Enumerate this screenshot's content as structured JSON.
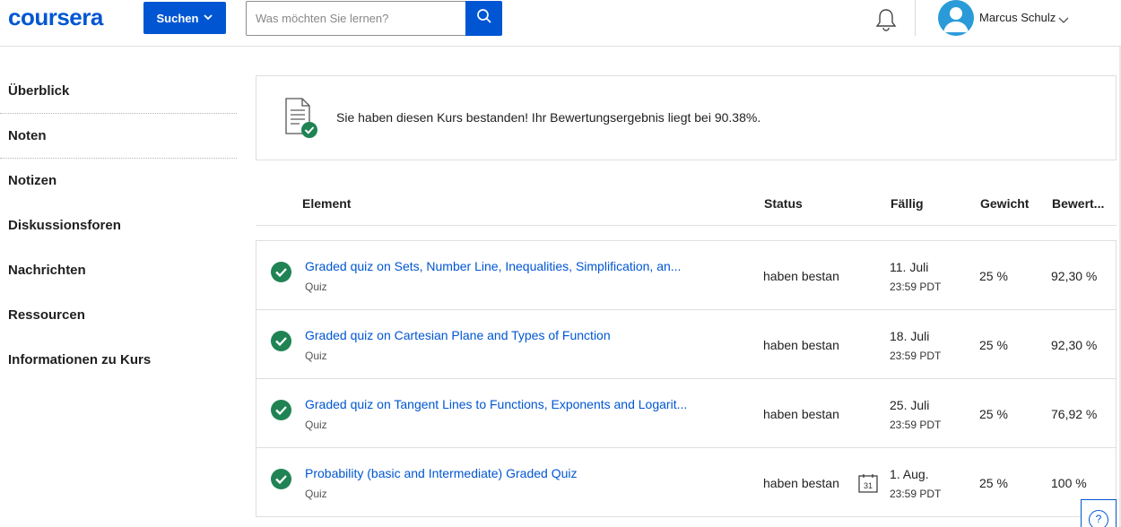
{
  "header": {
    "logo": "coursera",
    "search_toggle_label": "Suchen",
    "search_placeholder": "Was möchten Sie lernen?",
    "user_name": "Marcus Schulz"
  },
  "sidebar": {
    "items": [
      {
        "label": "Überblick"
      },
      {
        "label": "Noten"
      },
      {
        "label": "Notizen"
      },
      {
        "label": "Diskussionsforen"
      },
      {
        "label": "Nachrichten"
      },
      {
        "label": "Ressourcen"
      },
      {
        "label": "Informationen zu Kurs"
      }
    ],
    "active": "Noten"
  },
  "banner": {
    "text": "Sie haben diesen Kurs bestanden! Ihr Bewertungsergebnis liegt bei 90.38%."
  },
  "table": {
    "headers": {
      "element": "Element",
      "status": "Status",
      "due": "Fällig",
      "weight": "Gewicht",
      "grade": "Bewert..."
    },
    "rows": [
      {
        "title": "Graded quiz on Sets, Number Line, Inequalities, Simplification, an...",
        "type": "Quiz",
        "status": "haben bestan",
        "due_date": "11. Juli",
        "due_time": "23:59 PDT",
        "weight": "25 %",
        "grade": "92,30 %"
      },
      {
        "title": "Graded quiz on Cartesian Plane and Types of Function",
        "type": "Quiz",
        "status": "haben bestan",
        "due_date": "18. Juli",
        "due_time": "23:59 PDT",
        "weight": "25 %",
        "grade": "92,30 %"
      },
      {
        "title": "Graded quiz on Tangent Lines to Functions, Exponents and Logarit...",
        "type": "Quiz",
        "status": "haben bestan",
        "due_date": "25. Juli",
        "due_time": "23:59 PDT",
        "weight": "25 %",
        "grade": "76,92 %"
      },
      {
        "title": "Probability (basic and Intermediate) Graded Quiz",
        "type": "Quiz",
        "status": "haben bestan",
        "due_date": "1. Aug.",
        "due_time": "23:59 PDT",
        "weight": "25 %",
        "grade": "100 %",
        "calendar_day": "31"
      }
    ]
  },
  "help_label": "?",
  "colors": {
    "brand": "#0056d2",
    "success": "#1f8354",
    "avatar": "#2a9bd8"
  },
  "icons": [
    "search-icon",
    "chevron-down-icon",
    "bell-icon",
    "user-avatar-icon",
    "document-check-icon",
    "check-circle-icon",
    "calendar-icon",
    "help-icon"
  ]
}
